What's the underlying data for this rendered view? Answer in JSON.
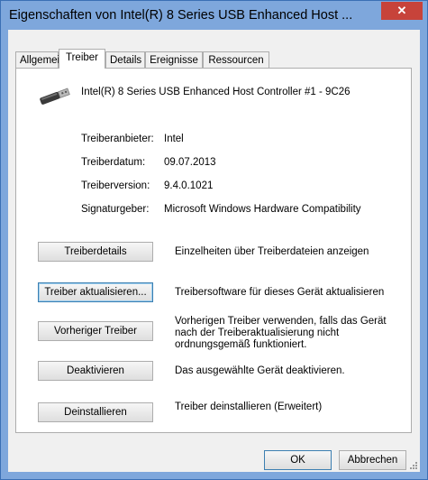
{
  "window": {
    "title": "Eigenschaften von Intel(R) 8 Series USB Enhanced Host ...",
    "close_label": "✕"
  },
  "tabs": [
    {
      "label": "Allgemein",
      "active": false
    },
    {
      "label": "Treiber",
      "active": true
    },
    {
      "label": "Details",
      "active": false
    },
    {
      "label": "Ereignisse",
      "active": false
    },
    {
      "label": "Ressourcen",
      "active": false
    }
  ],
  "device": {
    "icon": "usb-plug-icon",
    "name": "Intel(R) 8 Series USB Enhanced Host Controller #1 - 9C26"
  },
  "properties": [
    {
      "label": "Treiberanbieter:",
      "value": "Intel"
    },
    {
      "label": "Treiberdatum:",
      "value": "09.07.2013"
    },
    {
      "label": "Treiberversion:",
      "value": "9.4.0.1021"
    },
    {
      "label": "Signaturgeber:",
      "value": "Microsoft Windows Hardware Compatibility"
    }
  ],
  "actions": [
    {
      "label": "Treiberdetails",
      "description": "Einzelheiten über Treiberdateien anzeigen"
    },
    {
      "label": "Treiber aktualisieren...",
      "description": "Treibersoftware für dieses Gerät aktualisieren"
    },
    {
      "label": "Vorheriger Treiber",
      "description": "Vorherigen Treiber verwenden, falls das Gerät nach der Treiberaktualisierung nicht ordnungsgemäß funktioniert."
    },
    {
      "label": "Deaktivieren",
      "description": "Das ausgewählte Gerät deaktivieren."
    },
    {
      "label": "Deinstallieren",
      "description": "Treiber deinstallieren (Erweitert)"
    }
  ],
  "footer": {
    "ok_label": "OK",
    "cancel_label": "Abbrechen"
  },
  "colors": {
    "title_bar": "#7ea7dc",
    "close_button": "#c7433a",
    "dialog_background": "#f0f0f0"
  }
}
